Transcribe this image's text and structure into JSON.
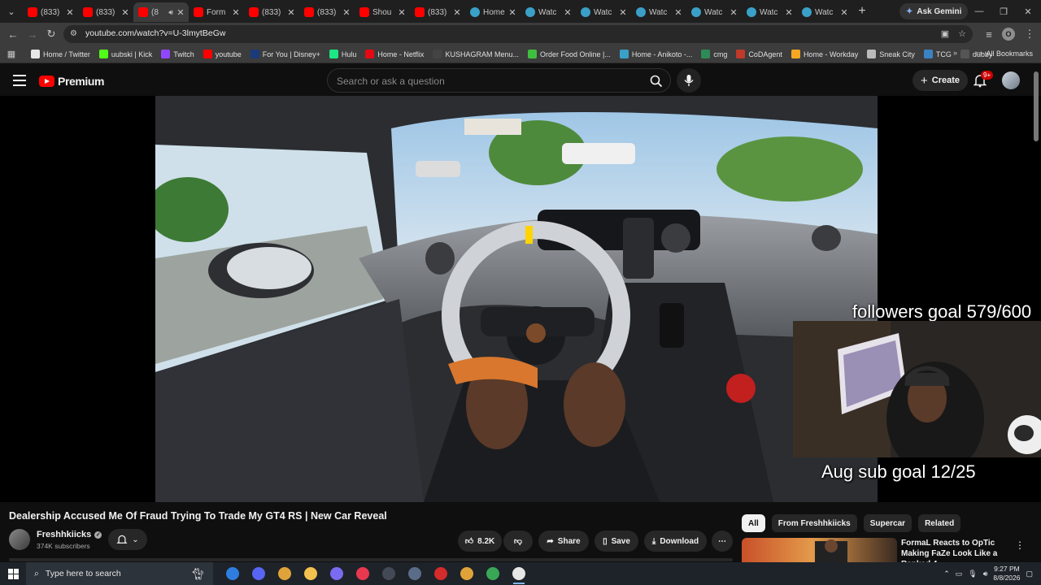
{
  "browser": {
    "tabs": [
      {
        "title": "(833)",
        "favicon": "youtube-icon",
        "active": false
      },
      {
        "title": "(833)",
        "favicon": "youtube-icon",
        "active": false
      },
      {
        "title": "(8",
        "favicon": "youtube-icon",
        "active": true,
        "audio": true
      },
      {
        "title": "Form",
        "favicon": "youtube-icon",
        "active": false
      },
      {
        "title": "(833)",
        "favicon": "youtube-icon",
        "active": false
      },
      {
        "title": "(833)",
        "favicon": "youtube-icon",
        "active": false
      },
      {
        "title": "Shou",
        "favicon": "youtube-icon",
        "active": false
      },
      {
        "title": "(833)",
        "favicon": "youtube-icon",
        "active": false
      },
      {
        "title": "Home",
        "favicon": "anikoto-icon",
        "active": false
      },
      {
        "title": "Watc",
        "favicon": "anikoto-icon",
        "active": false
      },
      {
        "title": "Watc",
        "favicon": "anikoto-icon",
        "active": false
      },
      {
        "title": "Watc",
        "favicon": "anikoto-icon",
        "active": false
      },
      {
        "title": "Watc",
        "favicon": "anikoto-icon",
        "active": false
      },
      {
        "title": "Watc",
        "favicon": "anikoto-icon",
        "active": false
      },
      {
        "title": "Watc",
        "favicon": "anikoto-icon",
        "active": false
      }
    ],
    "gemini_label": "Ask Gemini",
    "url": "youtube.com/watch?v=U-3lmytBeGw",
    "profile_initial": "O",
    "bookmarks": [
      {
        "label": "Home / Twitter",
        "color": "#e8e8e8"
      },
      {
        "label": "uubski | Kick",
        "color": "#53fc18"
      },
      {
        "label": "Twitch",
        "color": "#9146ff"
      },
      {
        "label": "youtube",
        "color": "#ff0000"
      },
      {
        "label": "For You | Disney+",
        "color": "#1a3a7a"
      },
      {
        "label": "Hulu",
        "color": "#1ce783"
      },
      {
        "label": "Home - Netflix",
        "color": "#e50914"
      },
      {
        "label": "KUSHAGRAM Menu...",
        "color": "#444444"
      },
      {
        "label": "Order Food Online |...",
        "color": "#3fbf3f"
      },
      {
        "label": "Home - Anikoto -...",
        "color": "#3aa0c8"
      },
      {
        "label": "cmg",
        "color": "#2e8b57"
      },
      {
        "label": "CoDAgent",
        "color": "#c0392b"
      },
      {
        "label": "Home - Workday",
        "color": "#f5a623"
      },
      {
        "label": "Sneak City",
        "color": "#bbbbbb"
      },
      {
        "label": "TCG",
        "color": "#3b82c4"
      },
      {
        "label": "dubby",
        "color": "#555555"
      }
    ],
    "all_bookmarks_label": "All Bookmarks"
  },
  "youtube": {
    "logo_text": "Premium",
    "search_placeholder": "Search or ask a question",
    "create_label": "Create",
    "notification_badge": "9+",
    "video": {
      "overlay_followers": "followers goal 579/600",
      "overlay_subs": "Aug sub goal 12/25"
    },
    "title": "Dealership Accused Me Of Fraud Trying To Trade My GT4 RS | New Car Reveal",
    "channel": {
      "name": "Freshhkiicks",
      "subscribers": "374K subscribers"
    },
    "actions": {
      "likes": "8.2K",
      "share": "Share",
      "save": "Save",
      "download": "Download"
    },
    "chips": [
      "All",
      "From Freshhkiicks",
      "Supercar",
      "Related"
    ],
    "recommended": {
      "title": "FormaL Reacts to OpTic Making FaZe Look Like a Ranked 4 ..."
    }
  },
  "taskbar": {
    "search_placeholder": "Type here to search",
    "time": "9:27 PM",
    "date": "8/8/2026"
  },
  "colors": {
    "accent": "#ff0000",
    "background": "#0f0f0f",
    "surface": "#272727"
  }
}
